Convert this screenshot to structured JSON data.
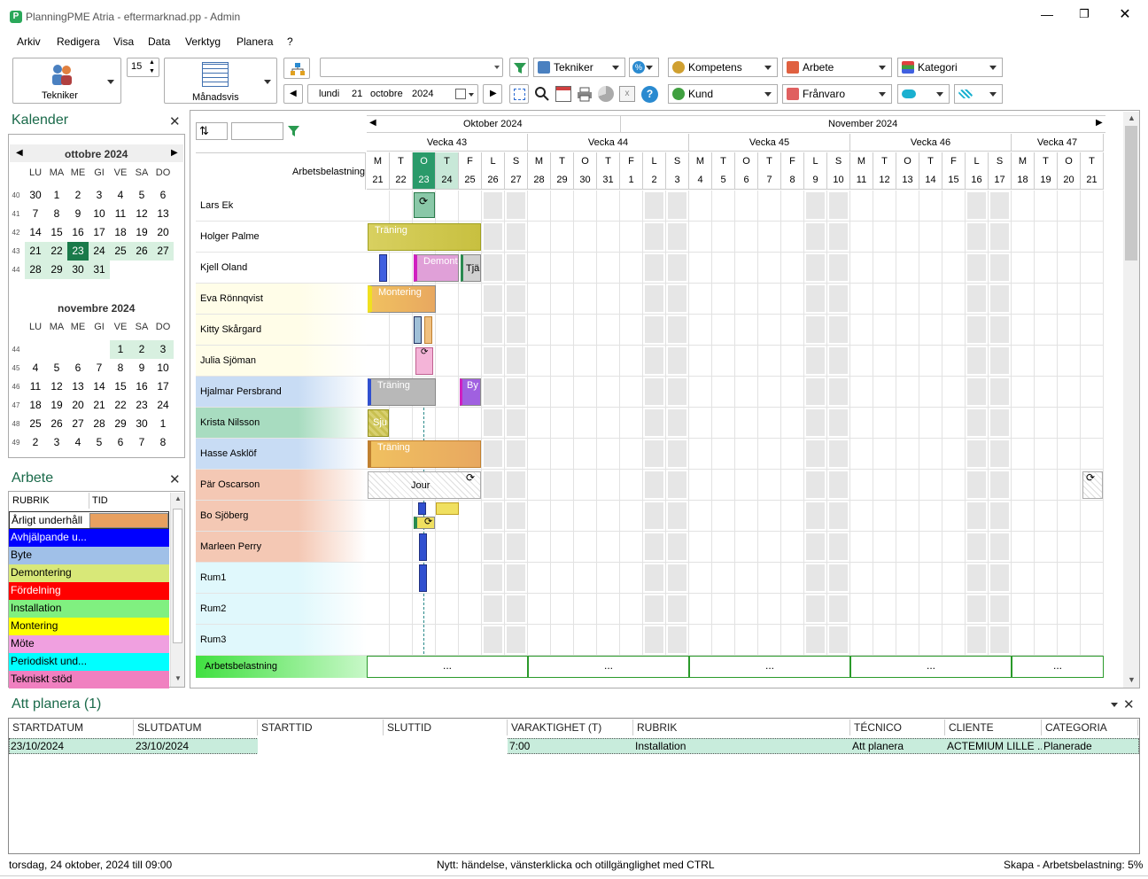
{
  "window": {
    "title": "PlanningPME Atria - eftermarknad.pp - Admin"
  },
  "menu": [
    "Arkiv",
    "Redigera",
    "Visa",
    "Data",
    "Verktyg",
    "Planera",
    "?"
  ],
  "toolbar": {
    "tekniker_button": "Tekniker",
    "spin_value": "15",
    "view_button": "Månadsvis",
    "date_day": "lundi",
    "date_num": "21",
    "date_month": "octobre",
    "date_year": "2024",
    "filter_tekniker": "Tekniker",
    "filter_kompetens": "Kompetens",
    "filter_arbete": "Arbete",
    "filter_kategori": "Kategori",
    "filter_kund": "Kund",
    "filter_franvaro": "Frånvaro"
  },
  "calendar_panel": {
    "title": "Kalender",
    "month1": {
      "name": "ottobre 2024",
      "headers": [
        "LU",
        "MA",
        "ME",
        "GI",
        "VE",
        "SA",
        "DO"
      ],
      "weeks": [
        {
          "wk": "40",
          "days": [
            "30",
            "1",
            "2",
            "3",
            "4",
            "5",
            "6"
          ]
        },
        {
          "wk": "41",
          "days": [
            "7",
            "8",
            "9",
            "10",
            "11",
            "12",
            "13"
          ]
        },
        {
          "wk": "42",
          "days": [
            "14",
            "15",
            "16",
            "17",
            "18",
            "19",
            "20"
          ]
        },
        {
          "wk": "43",
          "days": [
            "21",
            "22",
            "23",
            "24",
            "25",
            "26",
            "27"
          ]
        },
        {
          "wk": "44",
          "days": [
            "28",
            "29",
            "30",
            "31",
            "",
            "",
            ""
          ]
        }
      ]
    },
    "month2": {
      "name": "novembre 2024",
      "headers": [
        "LU",
        "MA",
        "ME",
        "GI",
        "VE",
        "SA",
        "DO"
      ],
      "weeks": [
        {
          "wk": "44",
          "days": [
            "",
            "",
            "",
            "",
            "1",
            "2",
            "3"
          ]
        },
        {
          "wk": "45",
          "days": [
            "4",
            "5",
            "6",
            "7",
            "8",
            "9",
            "10"
          ]
        },
        {
          "wk": "46",
          "days": [
            "11",
            "12",
            "13",
            "14",
            "15",
            "16",
            "17"
          ]
        },
        {
          "wk": "47",
          "days": [
            "18",
            "19",
            "20",
            "21",
            "22",
            "23",
            "24"
          ]
        },
        {
          "wk": "48",
          "days": [
            "25",
            "26",
            "27",
            "28",
            "29",
            "30",
            "1"
          ]
        },
        {
          "wk": "49",
          "days": [
            "2",
            "3",
            "4",
            "5",
            "6",
            "7",
            "8"
          ]
        }
      ]
    }
  },
  "arbete_panel": {
    "title": "Arbete",
    "col_rubrik": "RUBRIK",
    "col_tid": "TID",
    "items": [
      {
        "label": "Årligt underhåll",
        "color": "#d9d9d9",
        "bar": "#e8a060"
      },
      {
        "label": "Avhjälpande u...",
        "color": "#0000ff",
        "bar": "#0000ff"
      },
      {
        "label": "Byte",
        "color": "#a0c0e8",
        "bar": "#a0c0e8"
      },
      {
        "label": "Demontering",
        "color": "#d8e878",
        "bar": "#d8e878"
      },
      {
        "label": "Fördelning",
        "color": "#ff0000",
        "bar": "#ff0000"
      },
      {
        "label": "Installation",
        "color": "#80f080",
        "bar": "#80f080"
      },
      {
        "label": "Montering",
        "color": "#ffff00",
        "bar": "#ffff00"
      },
      {
        "label": "Möte",
        "color": "#f0a0e0",
        "bar": "#f0a0e0"
      },
      {
        "label": "Periodiskt und...",
        "color": "#00ffff",
        "bar": "#00ffff"
      },
      {
        "label": "Tekniskt stöd",
        "color": "#f080c0",
        "bar": "#f080c0"
      }
    ]
  },
  "planner": {
    "months": [
      "Oktober 2024",
      "November 2024"
    ],
    "weeks": [
      "Vecka 43",
      "Vecka 44",
      "Vecka 45",
      "Vecka 46",
      "Vecka 47"
    ],
    "header_label": "Arbetsbelastning",
    "day_letters": [
      "M",
      "T",
      "O",
      "T",
      "F",
      "L",
      "S",
      "M",
      "T",
      "O",
      "T",
      "F",
      "L",
      "S",
      "M",
      "T",
      "O",
      "T",
      "F",
      "L",
      "S",
      "M",
      "T",
      "O",
      "T",
      "F",
      "L",
      "S",
      "M",
      "T",
      "O",
      "T"
    ],
    "day_nums": [
      "21",
      "22",
      "23",
      "24",
      "25",
      "26",
      "27",
      "28",
      "29",
      "30",
      "31",
      "1",
      "2",
      "3",
      "4",
      "5",
      "6",
      "7",
      "8",
      "9",
      "10",
      "11",
      "12",
      "13",
      "14",
      "15",
      "16",
      "17",
      "18",
      "19",
      "20",
      "21"
    ],
    "rows": [
      {
        "name": "Lars Ek",
        "bg": "#ffffff"
      },
      {
        "name": "Holger Palme",
        "bg": "#ffffff"
      },
      {
        "name": "Kjell Oland",
        "bg": "#ffffff"
      },
      {
        "name": "Eva Rönnqvist",
        "bg": "#fffde8"
      },
      {
        "name": "Kitty Skårgard",
        "bg": "#fffde8"
      },
      {
        "name": "Julia Sjöman",
        "bg": "#fffde8"
      },
      {
        "name": "Hjalmar Persbrand",
        "bg": "#c8dcf4"
      },
      {
        "name": "Krista Nilsson",
        "bg": "#a8dcc0"
      },
      {
        "name": "Hasse Asklöf",
        "bg": "#c8dcf4"
      },
      {
        "name": "Pär Oscarson",
        "bg": "#f4c8b4"
      },
      {
        "name": "Bo Sjöberg",
        "bg": "#f4c8b4"
      },
      {
        "name": "Marleen Perry",
        "bg": "#f4c8b4"
      },
      {
        "name": "Rum1",
        "bg": "#e0f8fc"
      },
      {
        "name": "Rum2",
        "bg": "#e0f8fc"
      },
      {
        "name": "Rum3",
        "bg": "#e0f8fc"
      }
    ],
    "footer_label": "Arbetsbelastning",
    "footer_cells": [
      "...",
      "...",
      "...",
      "...",
      "..."
    ],
    "events": {
      "holger_traning": "Träning",
      "kjell_demont": "Demont",
      "kjell_tja": "Tjä",
      "eva_montering": "Montering",
      "hjalmar_traning": "Träning",
      "hjalmar_by": "By",
      "krista_sju": "Sju",
      "hasse_traning": "Träning",
      "par_jour": "Jour"
    }
  },
  "att_planera": {
    "title": "Att planera (1)",
    "columns": [
      "STARTDATUM",
      "SLUTDATUM",
      "STARTTID",
      "SLUTTID",
      "VARAKTIGHET (T)",
      "RUBRIK",
      "TÉCNICO",
      "CLIENTE",
      "CATEGORIA"
    ],
    "row": [
      "23/10/2024",
      "23/10/2024",
      "",
      "",
      "7:00",
      "Installation",
      "Att planera",
      "ACTEMIUM LILLE ...",
      "Planerade"
    ]
  },
  "status": {
    "left": "torsdag, 24 oktober, 2024 till 09:00",
    "center": "Nytt: händelse, vänsterklicka och otillgänglighet med CTRL",
    "right": "Skapa - Arbetsbelastning: 5%"
  }
}
